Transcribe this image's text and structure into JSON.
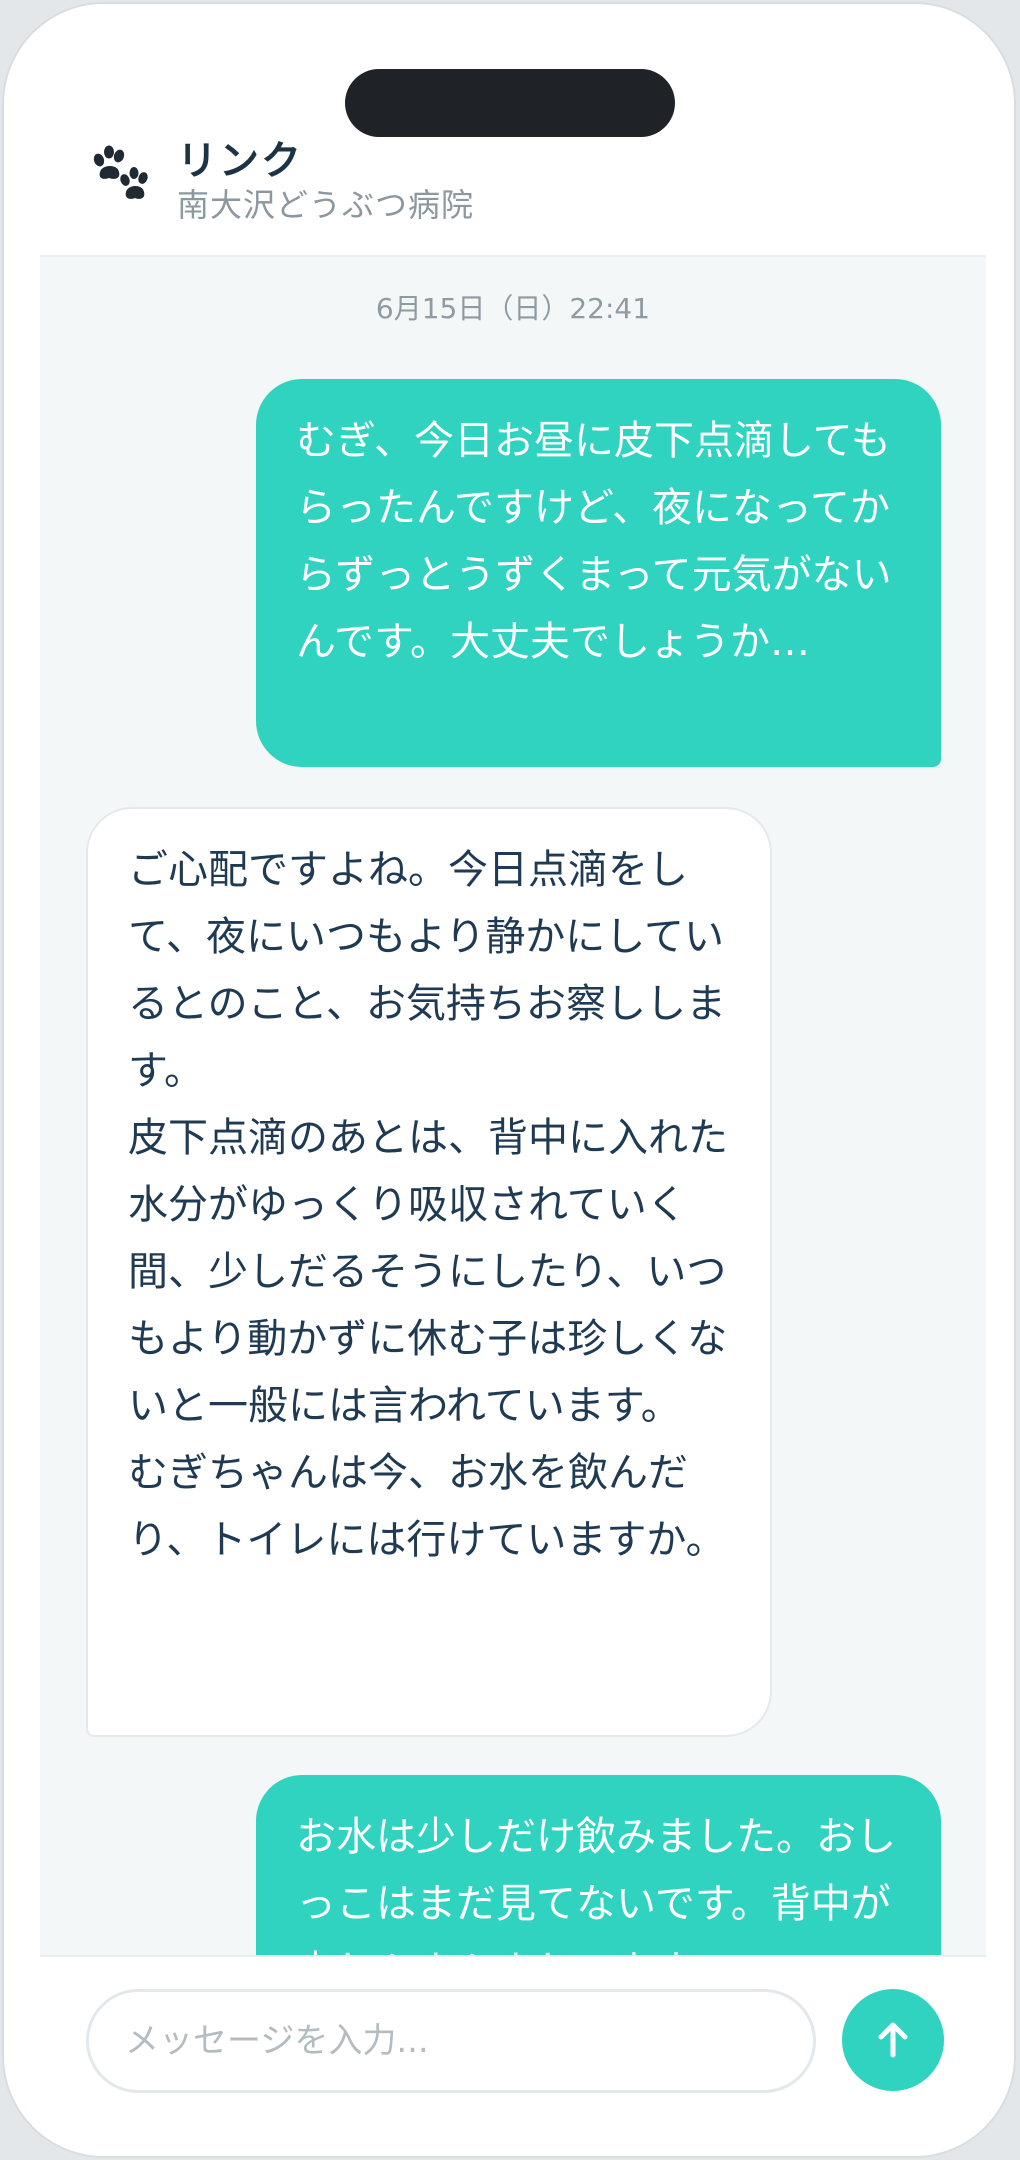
{
  "header": {
    "title": "リンク",
    "subtitle": "南大沢どうぶつ病院",
    "icon": "paw-icon"
  },
  "chat": {
    "timestamp": "6月15日（日）22:41",
    "messages": [
      {
        "sender": "user",
        "text": "むぎ、今日お昼に皮下点滴してもらったんですけど、夜になってからずっとうずくまって元気がないんです。大丈夫でしょうか…"
      },
      {
        "sender": "bot",
        "text": "ご心配ですよね。今日点滴をして、夜にいつもより静かにしているとのこと、お気持ちお察しします。\n皮下点滴のあとは、背中に入れた水分がゆっくり吸収されていく間、少しだるそうにしたり、いつもより動かずに休む子は珍しくないと一般には言われています。\nむぎちゃんは今、お水を飲んだり、トイレには行けていますか。"
      },
      {
        "sender": "user",
        "text": "お水は少しだけ飲みました。おしっこはまだ見てないです。背中が少しぷよぷよしてます"
      }
    ]
  },
  "composer": {
    "placeholder": "メッセージを入力...",
    "send_icon": "arrow-up-icon"
  },
  "colors": {
    "accent": "#2fd3c0",
    "title": "#1c3346",
    "subtitle": "#8c979e",
    "bot_text": "#1f3a52",
    "chat_bg": "#f4f7f8"
  }
}
